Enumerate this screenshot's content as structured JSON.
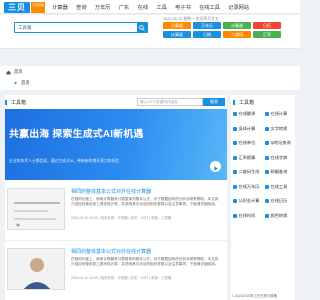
{
  "header": {
    "logo_mark": "三贝",
    "logo_sub": "计算器网",
    "nav": [
      "计算器",
      "查询",
      "万年历",
      "广东",
      "在线",
      "工具",
      "电子书",
      "在线工具",
      "记录网站"
    ]
  },
  "search": {
    "value": "工具箱",
    "placeholder": ""
  },
  "datetime": "2023-06-12 星期一 农历四月廿五",
  "chips": [
    {
      "label": "计算器",
      "color": "#ff8a00"
    },
    {
      "label": "万年历",
      "color": "#1a8fe0"
    },
    {
      "label": "计算器",
      "color": "#4caf50"
    },
    {
      "label": "日历",
      "color": "#f44336"
    },
    {
      "label": "计算器",
      "color": "#1a8fe0"
    },
    {
      "label": "日期",
      "color": "#1a8fe0"
    },
    {
      "label": "二维码",
      "color": "#ff8a00"
    },
    {
      "label": "汇率",
      "color": "#4caf50"
    }
  ],
  "breadcrumb": {
    "home": "首页",
    "rows": [
      "首页",
      "首页"
    ]
  },
  "main": {
    "heading": "工具箱",
    "search_placeholder": "输入1-5个关键词开始查",
    "search_button": "搜索",
    "banner": {
      "headline": "共赢出海 探索生成式AI新机遇",
      "paragraph": "企业和技术人士都会说，通过生成式AI，带来新的增长潜力和机会"
    },
    "articles": [
      {
        "title": "相同的整体基本公式对外在线计算器",
        "desc": "在相同长度上，使用计算器来计算整体的基本公式，对于数据结构的分析非常有帮助。本文将介绍如何使用该工具完成计算，并说明其中涉及的相关参数以及注意事项，下面请详细阅读。",
        "meta": "2023-06-12 10:00 | 相关标签：计算器 | 浏览：1027 | 来源：工具箱"
      },
      {
        "title": "相同的整体基本公式对外在线计算器",
        "desc": "在相同长度上，使用计算器来计算整体的基本公式，对于数据结构的分析非常有帮助。本文将介绍如何使用该工具完成计算，并说明其中涉及的相关参数以及注意事项，下面请详细阅读。",
        "meta": "2023-06-12 10:00 | 相关标签：计算器 | 浏览：1027 | 来源：工具箱"
      }
    ]
  },
  "side": {
    "heading": "工具箱",
    "items": [
      "在线翻译",
      "在线计算",
      "身体计算",
      "文字转换",
      "在线单位",
      "Ip地址查询",
      "汇率换算",
      "在线字典",
      "二维码生成",
      "邮编查询",
      "在线万年历",
      "在线工具",
      "公积金计算",
      "在线日历",
      "在线时间",
      "颜色转换"
    ],
    "footer": "1-4021/2023年工作日的计算器"
  }
}
